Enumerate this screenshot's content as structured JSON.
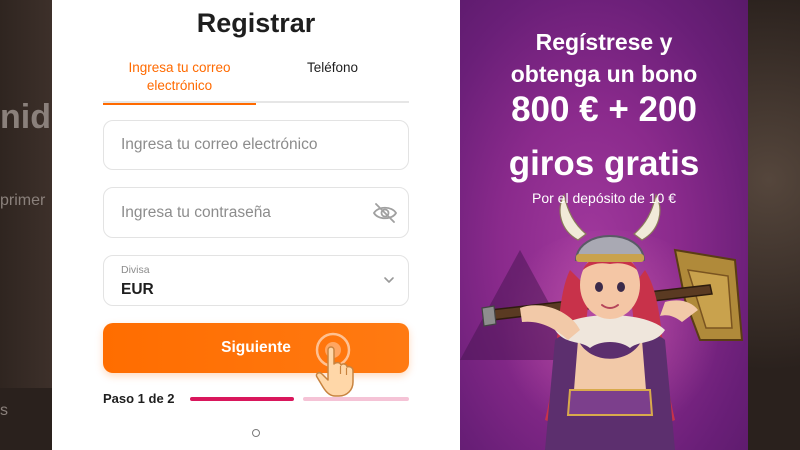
{
  "background": {
    "partial_heading": "nid",
    "partial_text": "primer",
    "partial_text_bottom": "s"
  },
  "form": {
    "title": "Registrar",
    "tabs": [
      {
        "label": "Ingresa tu correo electrónico",
        "active": true
      },
      {
        "label": "Teléfono",
        "active": false
      }
    ],
    "email_placeholder": "Ingresa tu correo electrónico",
    "password_placeholder": "Ingresa tu contraseña",
    "currency_label": "Divisa",
    "currency_value": "EUR",
    "next_button": "Siguiente",
    "step_text": "Paso 1 de 2",
    "progress": 0.5
  },
  "promo": {
    "line1": "Regístrese y",
    "line2": "obtenga un bono",
    "amount": "800 € + 200",
    "spins": "giros gratis",
    "condition": "Por el depósito de 10 €"
  },
  "colors": {
    "accent": "#ff6a00",
    "progress_active": "#d9175c",
    "progress_inactive": "#f5c3d6",
    "promo_bg": "#8a2a8c"
  },
  "icons": [
    "eye-slash-icon",
    "chevron-down-icon",
    "pointer-hand-icon",
    "viking-warrior-illustration"
  ]
}
